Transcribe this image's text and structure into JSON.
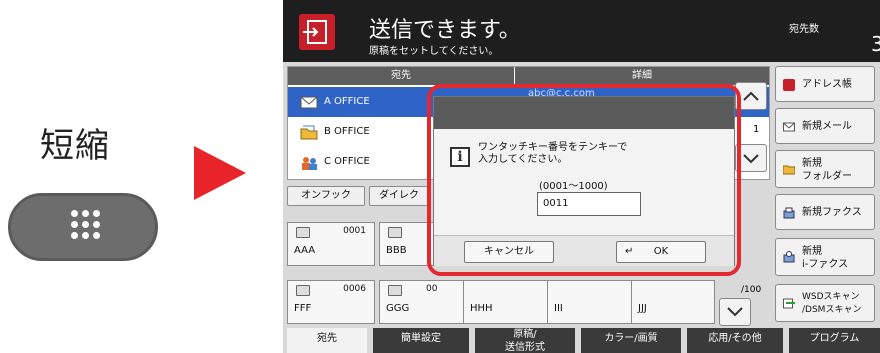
{
  "left": {
    "label": "短縮"
  },
  "header": {
    "title": "送信できます。",
    "subtitle": "原稿をセットしてください。",
    "count_label": "宛先数",
    "count_value": "3"
  },
  "destinations": {
    "col_dest": "宛先",
    "col_detail": "詳細",
    "rows": [
      {
        "name": "A OFFICE",
        "detail": "abc@c.c.com",
        "selected": true
      },
      {
        "name": "B OFFICE",
        "detail": "",
        "selected": false
      },
      {
        "name": "C OFFICE",
        "detail": "",
        "selected": false
      }
    ]
  },
  "side_buttons": [
    "アドレス帳",
    "新規メール",
    "新規\nフォルダー",
    "新規ファクス",
    "新規\ni-ファクス",
    "WSDスキャン\n/DSMスキャン"
  ],
  "tabs": {
    "onhook": "オンフック",
    "direct": "ダイレク"
  },
  "keys": {
    "row1": [
      {
        "num": "0001",
        "name": "AAA"
      },
      {
        "num": "",
        "name": "BBB"
      }
    ],
    "row2": [
      {
        "num": "0006",
        "name": "FFF"
      },
      {
        "num": "",
        "name": "GGG"
      },
      {
        "num": "",
        "name": "HHH"
      },
      {
        "num": "",
        "name": "III"
      },
      {
        "num": "",
        "name": "JJJ"
      }
    ],
    "partial_num": "00",
    "page_indicator": "/100",
    "scroll_partial": "1"
  },
  "dialog": {
    "message": "ワンタッチキー番号をテンキーで\n入力してください。",
    "range": "(0001～1000)",
    "input_value": "0011",
    "cancel_label": "キャンセル",
    "ok_label": "OK"
  },
  "bottom_tabs": [
    "宛先",
    "簡単設定",
    "原稿/\n送信形式",
    "カラー/画質",
    "応用/その他",
    "プログラム"
  ],
  "colors": {
    "highlight": "#e3282f",
    "selected_row": "#2f63c6",
    "header_bg": "#1e1e1e",
    "arrow": "#e8232a"
  }
}
